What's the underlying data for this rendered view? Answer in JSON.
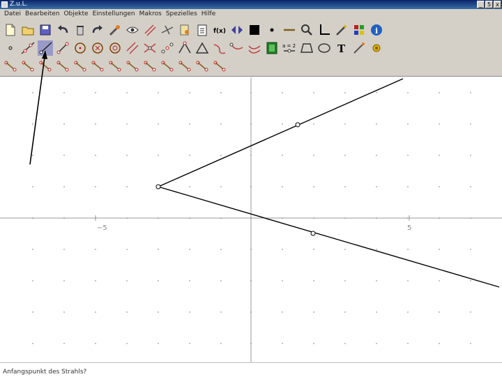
{
  "window": {
    "title": "Z.u.L."
  },
  "window_controls": {
    "minimize": "_",
    "maximize": "5",
    "close": "x"
  },
  "menu": [
    "Datei",
    "Bearbeiten",
    "Objekte",
    "Einstellungen",
    "Makros",
    "Spezielles",
    "Hilfe"
  ],
  "toolbar": {
    "rows": [
      [
        "new-file",
        "open-file",
        "save-file",
        "undo",
        "delete",
        "redo",
        "edit-tool",
        "hide-tool",
        "parallel-tool",
        "perpendicular-tool",
        "paste-tool",
        "clipboard-tool",
        "function-tool",
        "reflect-tool",
        "fill-color",
        "point-style",
        "line-style",
        "zoom-tool",
        "axes-tool",
        "wand-tool",
        "color-grid",
        "info-tool"
      ],
      [
        "point-tool",
        "line-tool",
        "ray-tool",
        "segment-tool",
        "circle-tool",
        "circle-3pt-tool",
        "fixed-circle-tool",
        "parallel-line-tool",
        "intersection-tool",
        "midpoint-tool",
        "angle-tool",
        "fixed-angle-tool",
        "bisector-tool",
        "arc-tool",
        "curve-tool",
        "image-tool",
        "expression-tool",
        "polygon-tool",
        "conic-tool",
        "text-tool",
        "track-tool",
        "animate-tool"
      ],
      [
        "macro-tool-1",
        "macro-tool-2",
        "macro-tool-3",
        "macro-tool-4",
        "macro-tool-5",
        "macro-tool-6",
        "macro-tool-7",
        "macro-tool-8",
        "macro-tool-9",
        "macro-tool-10",
        "macro-tool-11",
        "macro-tool-12",
        "macro-tool-13"
      ]
    ],
    "active": "ray-tool"
  },
  "canvas": {
    "axis_labels": {
      "x_neg": "−5",
      "x_pos": "5"
    }
  },
  "status": {
    "text": "Anfangspunkt des Strahls?"
  }
}
